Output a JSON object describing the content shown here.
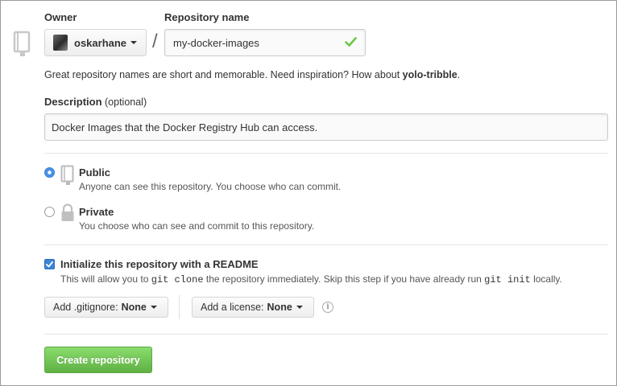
{
  "owner": {
    "label": "Owner",
    "username": "oskarhane"
  },
  "repository": {
    "label": "Repository name",
    "value": "my-docker-images",
    "separator": "/"
  },
  "hint": {
    "prefix": "Great repository names are short and memorable. Need inspiration? How about ",
    "suggestion": "yolo-tribble",
    "suffix": "."
  },
  "description": {
    "label": "Description",
    "optional": "(optional)",
    "value": "Docker Images that the Docker Registry Hub can access."
  },
  "visibility": {
    "public": {
      "title": "Public",
      "subtitle": "Anyone can see this repository. You choose who can commit.",
      "selected": true
    },
    "private": {
      "title": "Private",
      "subtitle": "You choose who can see and commit to this repository.",
      "selected": false
    }
  },
  "readme": {
    "label": "Initialize this repository with a README",
    "checked": true,
    "help_prefix": "This will allow you to ",
    "help_code1": "git clone",
    "help_middle": " the repository immediately. Skip this step if you have already run ",
    "help_code2": "git init",
    "help_suffix": " locally."
  },
  "gitignore": {
    "label": "Add .gitignore:",
    "value": "None"
  },
  "license": {
    "label": "Add a license:",
    "value": "None"
  },
  "create_button": "Create repository",
  "colors": {
    "accent_blue": "#4a90e2",
    "check_green": "#6cc644",
    "create_green": "#60b044"
  },
  "icons": [
    "repo-icon",
    "chevron-down-icon",
    "check-icon",
    "book-icon",
    "lock-icon",
    "info-icon"
  ]
}
